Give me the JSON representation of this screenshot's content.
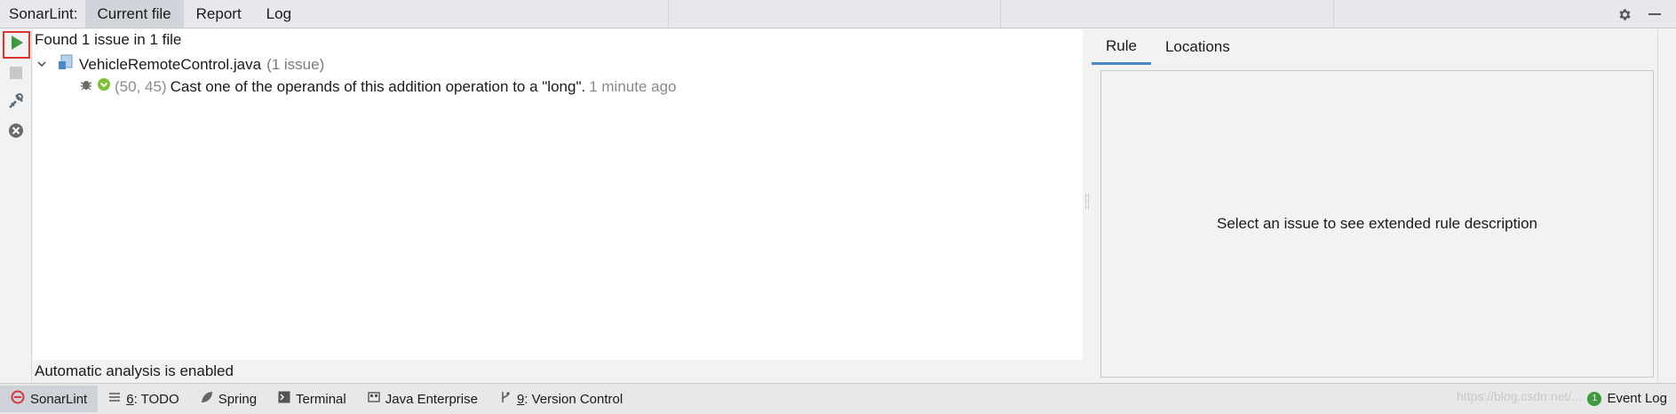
{
  "header": {
    "title": "SonarLint:",
    "tabs": [
      {
        "label": "Current file",
        "active": true
      },
      {
        "label": "Report",
        "active": false
      },
      {
        "label": "Log",
        "active": false
      }
    ],
    "icons": [
      "gear-icon",
      "minimize-icon"
    ]
  },
  "left_toolbar": {
    "buttons": [
      "run-icon",
      "stop-icon",
      "configure-icon",
      "clear-icon"
    ]
  },
  "tree": {
    "summary": "Found 1 issue in 1 file",
    "file": {
      "name": "VehicleRemoteControl.java",
      "count": "(1 issue)"
    },
    "issue": {
      "location": "(50, 45)",
      "message": "Cast one of the operands of this addition operation to a \"long\".",
      "time": "1 minute ago"
    },
    "status": "Automatic analysis is enabled"
  },
  "rule_panel": {
    "tabs": [
      {
        "label": "Rule",
        "active": true
      },
      {
        "label": "Locations",
        "active": false
      }
    ],
    "placeholder": "Select an issue to see extended rule description"
  },
  "bottom_bar": {
    "items": [
      {
        "label": "SonarLint",
        "mnemonic": "",
        "active": true
      },
      {
        "mnemonic": "6",
        "label": ": TODO"
      },
      {
        "mnemonic": "",
        "label": "Spring"
      },
      {
        "mnemonic": "",
        "label": "Terminal"
      },
      {
        "mnemonic": "",
        "label": "Java Enterprise"
      },
      {
        "mnemonic": "9",
        "label": ": Version Control"
      }
    ],
    "watermark": "https://blog.csdn.net/...",
    "event_log": "Event Log",
    "event_log_badge": "1"
  },
  "colors": {
    "accent_tab": "#4a88c7",
    "run_green": "#3e9a3e",
    "highlight_red": "#e0322f"
  }
}
